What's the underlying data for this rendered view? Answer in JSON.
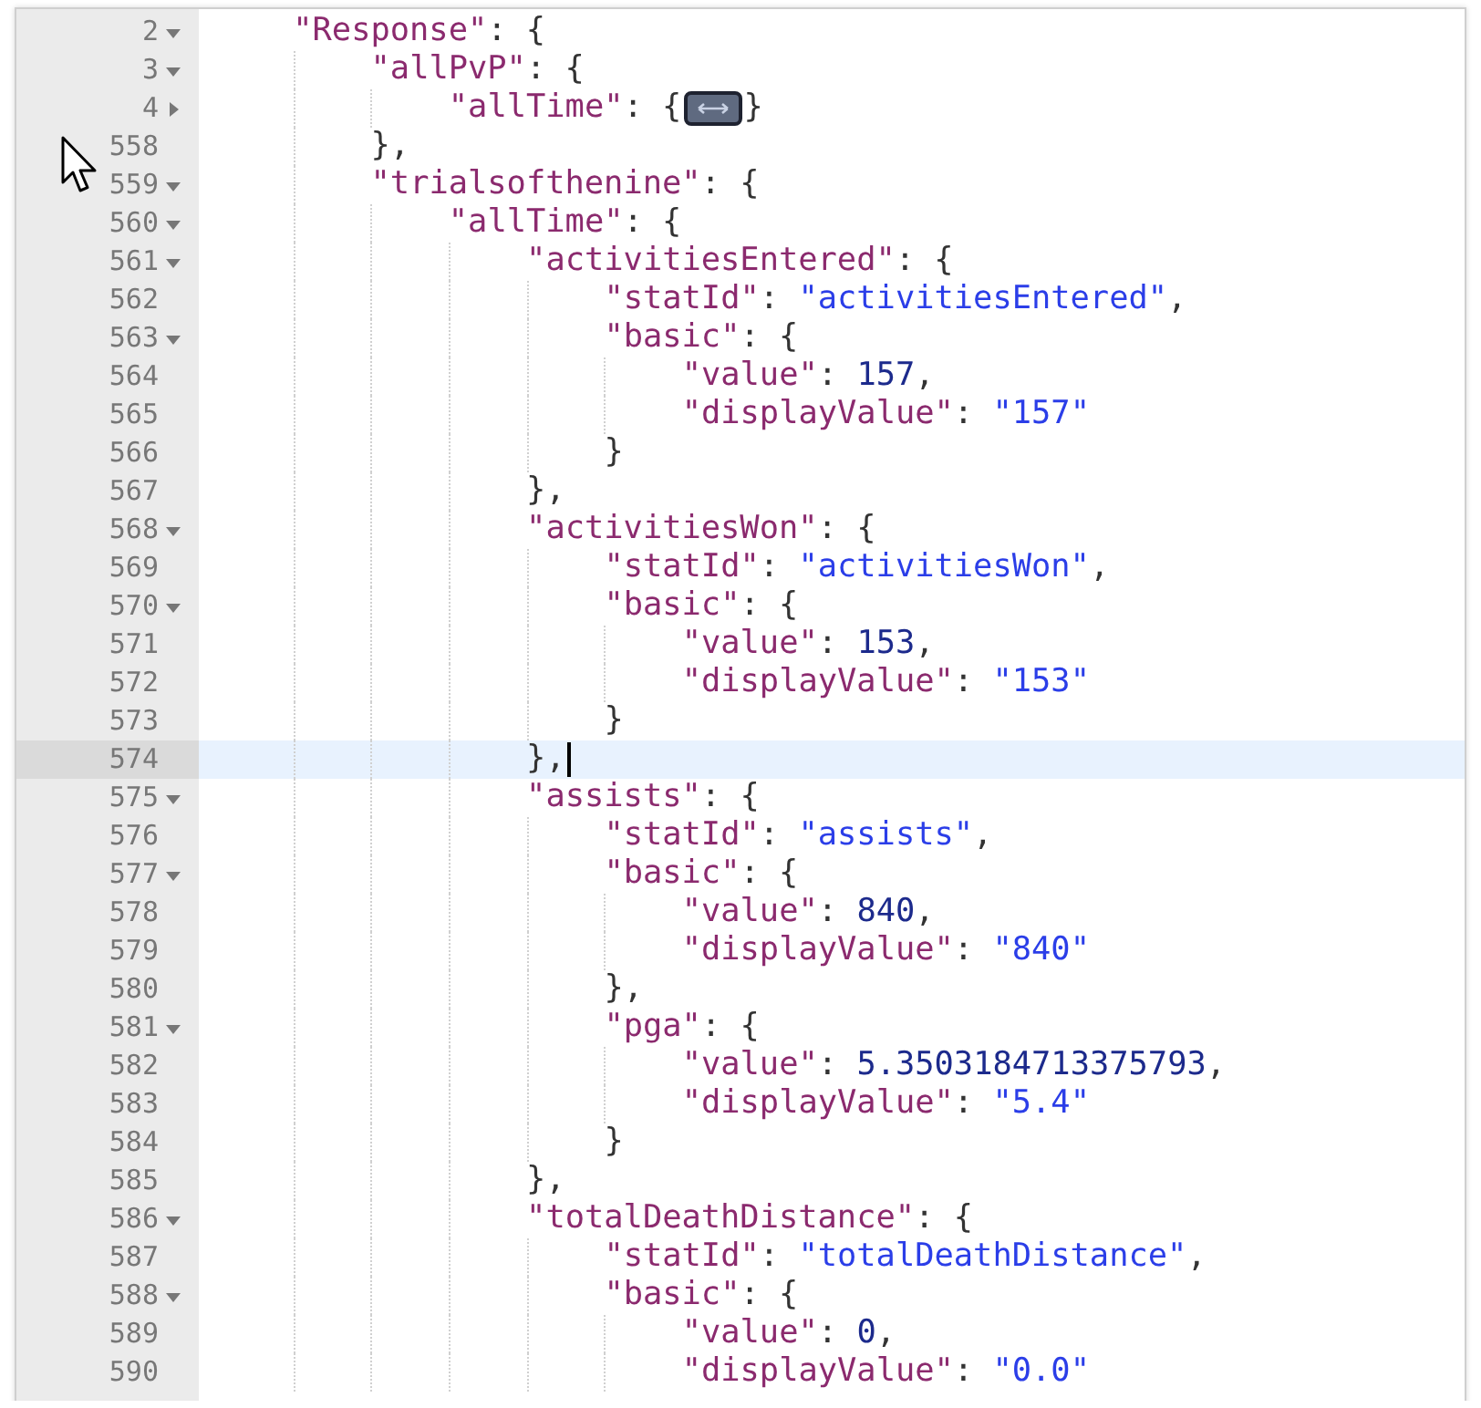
{
  "editor": {
    "lines": [
      {
        "number": "2",
        "foldable": true,
        "expanded": true,
        "active": false,
        "tokens": [
          {
            "kind": "key",
            "text": "\"Response\""
          },
          {
            "kind": "punct",
            "text": ": {"
          }
        ],
        "children": [
          {
            "number": "3",
            "foldable": true,
            "expanded": true,
            "active": false,
            "tokens": [
              {
                "kind": "key",
                "text": "\"allPvP\""
              },
              {
                "kind": "punct",
                "text": ": {"
              }
            ],
            "children": [
              {
                "number": "4",
                "foldable": true,
                "expanded": false,
                "active": false,
                "tokens": [
                  {
                    "kind": "key",
                    "text": "\"allTime\""
                  },
                  {
                    "kind": "punct",
                    "text": ": {"
                  },
                  {
                    "kind": "folded"
                  },
                  {
                    "kind": "punct",
                    "text": "}"
                  }
                ]
              }
            ]
          },
          {
            "number": "558",
            "foldable": false,
            "active": false,
            "tokens": [
              {
                "kind": "punct",
                "text": "},"
              }
            ]
          },
          {
            "number": "559",
            "foldable": true,
            "expanded": true,
            "active": false,
            "tokens": [
              {
                "kind": "key",
                "text": "\"trialsofthenine\""
              },
              {
                "kind": "punct",
                "text": ": {"
              }
            ],
            "children": [
              {
                "number": "560",
                "foldable": true,
                "expanded": true,
                "active": false,
                "tokens": [
                  {
                    "kind": "key",
                    "text": "\"allTime\""
                  },
                  {
                    "kind": "punct",
                    "text": ": {"
                  }
                ],
                "children": [
                  {
                    "number": "561",
                    "foldable": true,
                    "expanded": true,
                    "active": false,
                    "tokens": [
                      {
                        "kind": "key",
                        "text": "\"activitiesEntered\""
                      },
                      {
                        "kind": "punct",
                        "text": ": {"
                      }
                    ],
                    "children": [
                      {
                        "number": "562",
                        "foldable": false,
                        "active": false,
                        "tokens": [
                          {
                            "kind": "key",
                            "text": "\"statId\""
                          },
                          {
                            "kind": "punct",
                            "text": ": "
                          },
                          {
                            "kind": "string",
                            "text": "\"activitiesEntered\""
                          },
                          {
                            "kind": "punct",
                            "text": ","
                          }
                        ]
                      },
                      {
                        "number": "563",
                        "foldable": true,
                        "expanded": true,
                        "active": false,
                        "tokens": [
                          {
                            "kind": "key",
                            "text": "\"basic\""
                          },
                          {
                            "kind": "punct",
                            "text": ": {"
                          }
                        ],
                        "children": [
                          {
                            "number": "564",
                            "foldable": false,
                            "active": false,
                            "tokens": [
                              {
                                "kind": "key",
                                "text": "\"value\""
                              },
                              {
                                "kind": "punct",
                                "text": ": "
                              },
                              {
                                "kind": "number",
                                "text": "157"
                              },
                              {
                                "kind": "punct",
                                "text": ","
                              }
                            ]
                          },
                          {
                            "number": "565",
                            "foldable": false,
                            "active": false,
                            "tokens": [
                              {
                                "kind": "key",
                                "text": "\"displayValue\""
                              },
                              {
                                "kind": "punct",
                                "text": ": "
                              },
                              {
                                "kind": "string",
                                "text": "\"157\""
                              }
                            ]
                          }
                        ]
                      },
                      {
                        "number": "566",
                        "foldable": false,
                        "active": false,
                        "tokens": [
                          {
                            "kind": "punct",
                            "text": "}"
                          }
                        ]
                      }
                    ]
                  },
                  {
                    "number": "567",
                    "foldable": false,
                    "active": false,
                    "tokens": [
                      {
                        "kind": "punct",
                        "text": "},"
                      }
                    ]
                  },
                  {
                    "number": "568",
                    "foldable": true,
                    "expanded": true,
                    "active": false,
                    "tokens": [
                      {
                        "kind": "key",
                        "text": "\"activitiesWon\""
                      },
                      {
                        "kind": "punct",
                        "text": ": {"
                      }
                    ],
                    "children": [
                      {
                        "number": "569",
                        "foldable": false,
                        "active": false,
                        "tokens": [
                          {
                            "kind": "key",
                            "text": "\"statId\""
                          },
                          {
                            "kind": "punct",
                            "text": ": "
                          },
                          {
                            "kind": "string",
                            "text": "\"activitiesWon\""
                          },
                          {
                            "kind": "punct",
                            "text": ","
                          }
                        ]
                      },
                      {
                        "number": "570",
                        "foldable": true,
                        "expanded": true,
                        "active": false,
                        "tokens": [
                          {
                            "kind": "key",
                            "text": "\"basic\""
                          },
                          {
                            "kind": "punct",
                            "text": ": {"
                          }
                        ],
                        "children": [
                          {
                            "number": "571",
                            "foldable": false,
                            "active": false,
                            "tokens": [
                              {
                                "kind": "key",
                                "text": "\"value\""
                              },
                              {
                                "kind": "punct",
                                "text": ": "
                              },
                              {
                                "kind": "number",
                                "text": "153"
                              },
                              {
                                "kind": "punct",
                                "text": ","
                              }
                            ]
                          },
                          {
                            "number": "572",
                            "foldable": false,
                            "active": false,
                            "tokens": [
                              {
                                "kind": "key",
                                "text": "\"displayValue\""
                              },
                              {
                                "kind": "punct",
                                "text": ": "
                              },
                              {
                                "kind": "string",
                                "text": "\"153\""
                              }
                            ]
                          }
                        ]
                      },
                      {
                        "number": "573",
                        "foldable": false,
                        "active": false,
                        "tokens": [
                          {
                            "kind": "punct",
                            "text": "}"
                          }
                        ]
                      }
                    ]
                  },
                  {
                    "number": "574",
                    "foldable": false,
                    "active": true,
                    "tokens": [
                      {
                        "kind": "punct",
                        "text": "},"
                      }
                    ]
                  },
                  {
                    "number": "575",
                    "foldable": true,
                    "expanded": true,
                    "active": false,
                    "tokens": [
                      {
                        "kind": "key",
                        "text": "\"assists\""
                      },
                      {
                        "kind": "punct",
                        "text": ": {"
                      }
                    ],
                    "children": [
                      {
                        "number": "576",
                        "foldable": false,
                        "active": false,
                        "tokens": [
                          {
                            "kind": "key",
                            "text": "\"statId\""
                          },
                          {
                            "kind": "punct",
                            "text": ": "
                          },
                          {
                            "kind": "string",
                            "text": "\"assists\""
                          },
                          {
                            "kind": "punct",
                            "text": ","
                          }
                        ]
                      },
                      {
                        "number": "577",
                        "foldable": true,
                        "expanded": true,
                        "active": false,
                        "tokens": [
                          {
                            "kind": "key",
                            "text": "\"basic\""
                          },
                          {
                            "kind": "punct",
                            "text": ": {"
                          }
                        ],
                        "children": [
                          {
                            "number": "578",
                            "foldable": false,
                            "active": false,
                            "tokens": [
                              {
                                "kind": "key",
                                "text": "\"value\""
                              },
                              {
                                "kind": "punct",
                                "text": ": "
                              },
                              {
                                "kind": "number",
                                "text": "840"
                              },
                              {
                                "kind": "punct",
                                "text": ","
                              }
                            ]
                          },
                          {
                            "number": "579",
                            "foldable": false,
                            "active": false,
                            "tokens": [
                              {
                                "kind": "key",
                                "text": "\"displayValue\""
                              },
                              {
                                "kind": "punct",
                                "text": ": "
                              },
                              {
                                "kind": "string",
                                "text": "\"840\""
                              }
                            ]
                          }
                        ]
                      },
                      {
                        "number": "580",
                        "foldable": false,
                        "active": false,
                        "tokens": [
                          {
                            "kind": "punct",
                            "text": "},"
                          }
                        ]
                      },
                      {
                        "number": "581",
                        "foldable": true,
                        "expanded": true,
                        "active": false,
                        "tokens": [
                          {
                            "kind": "key",
                            "text": "\"pga\""
                          },
                          {
                            "kind": "punct",
                            "text": ": {"
                          }
                        ],
                        "children": [
                          {
                            "number": "582",
                            "foldable": false,
                            "active": false,
                            "tokens": [
                              {
                                "kind": "key",
                                "text": "\"value\""
                              },
                              {
                                "kind": "punct",
                                "text": ": "
                              },
                              {
                                "kind": "number",
                                "text": "5.3503184713375793"
                              },
                              {
                                "kind": "punct",
                                "text": ","
                              }
                            ]
                          },
                          {
                            "number": "583",
                            "foldable": false,
                            "active": false,
                            "tokens": [
                              {
                                "kind": "key",
                                "text": "\"displayValue\""
                              },
                              {
                                "kind": "punct",
                                "text": ": "
                              },
                              {
                                "kind": "string",
                                "text": "\"5.4\""
                              }
                            ]
                          }
                        ]
                      },
                      {
                        "number": "584",
                        "foldable": false,
                        "active": false,
                        "tokens": [
                          {
                            "kind": "punct",
                            "text": "}"
                          }
                        ]
                      }
                    ]
                  },
                  {
                    "number": "585",
                    "foldable": false,
                    "active": false,
                    "tokens": [
                      {
                        "kind": "punct",
                        "text": "},"
                      }
                    ]
                  },
                  {
                    "number": "586",
                    "foldable": true,
                    "expanded": true,
                    "active": false,
                    "tokens": [
                      {
                        "kind": "key",
                        "text": "\"totalDeathDistance\""
                      },
                      {
                        "kind": "punct",
                        "text": ": {"
                      }
                    ],
                    "children": [
                      {
                        "number": "587",
                        "foldable": false,
                        "active": false,
                        "tokens": [
                          {
                            "kind": "key",
                            "text": "\"statId\""
                          },
                          {
                            "kind": "punct",
                            "text": ": "
                          },
                          {
                            "kind": "string",
                            "text": "\"totalDeathDistance\""
                          },
                          {
                            "kind": "punct",
                            "text": ","
                          }
                        ]
                      },
                      {
                        "number": "588",
                        "foldable": true,
                        "expanded": true,
                        "active": false,
                        "tokens": [
                          {
                            "kind": "key",
                            "text": "\"basic\""
                          },
                          {
                            "kind": "punct",
                            "text": ": {"
                          }
                        ],
                        "children": [
                          {
                            "number": "589",
                            "foldable": false,
                            "active": false,
                            "tokens": [
                              {
                                "kind": "key",
                                "text": "\"value\""
                              },
                              {
                                "kind": "punct",
                                "text": ": "
                              },
                              {
                                "kind": "number",
                                "text": "0"
                              },
                              {
                                "kind": "punct",
                                "text": ","
                              }
                            ]
                          },
                          {
                            "number": "590",
                            "foldable": false,
                            "active": false,
                            "tokens": [
                              {
                                "kind": "key",
                                "text": "\"displayValue\""
                              },
                              {
                                "kind": "punct",
                                "text": ": "
                              },
                              {
                                "kind": "string",
                                "text": "\"0.0\""
                              }
                            ]
                          }
                        ]
                      }
                    ]
                  }
                ]
              }
            ]
          }
        ]
      }
    ]
  }
}
